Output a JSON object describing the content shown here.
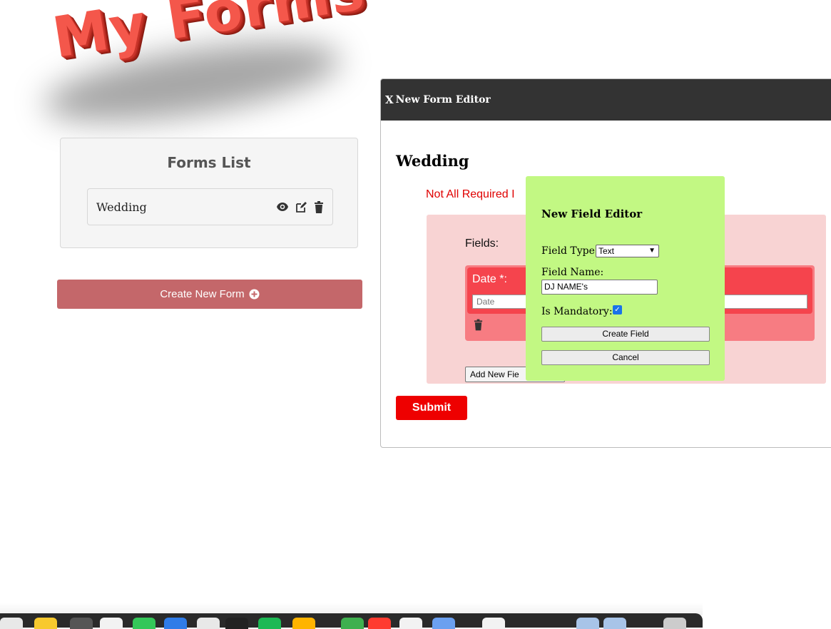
{
  "logo": {
    "text": "My Forms"
  },
  "forms_list": {
    "title": "Forms List",
    "items": [
      {
        "name": "Wedding"
      }
    ],
    "create_button_label": "Create New Form"
  },
  "editor": {
    "close_label": "X",
    "header_title": "New Form Editor",
    "form_title": "Wedding",
    "error_message": "Not All Required I",
    "fields_label": "Fields:",
    "field": {
      "label": "Date *:",
      "placeholder": "Date"
    },
    "add_field_label": "Add New Fie",
    "submit_label": "Submit"
  },
  "field_editor": {
    "title": "New Field Editor",
    "field_type_label": "Field Type:",
    "field_type_value": "Text",
    "field_name_label": "Field Name:",
    "field_name_value": "DJ NAME's",
    "mandatory_label": "Is Mandatory:",
    "mandatory_checked": true,
    "create_label": "Create Field",
    "cancel_label": "Cancel"
  },
  "dock": {
    "icons": [
      "finder-icon",
      "notes-icon",
      "launchpad-icon",
      "safari-icon",
      "messages-icon",
      "mail-icon",
      "chrome-icon",
      "github-icon",
      "spotify-icon",
      "app-icon",
      "app-icon",
      "app-icon",
      "app-icon",
      "app-icon",
      "doc-icon",
      "window-icon",
      "window-icon",
      "trash-icon"
    ],
    "colors": [
      "#e8e8e8",
      "#f8c92e",
      "#555555",
      "#f2f2f2",
      "#34c759",
      "#2f7ce8",
      "#e8e8e8",
      "#222222",
      "#1db954",
      "#ffb400",
      "#3fb04f",
      "#ff3b30",
      "#f2f2f2",
      "#6ba0f0",
      "#f2f2f2",
      "#a8c4e8",
      "#a8c4e8",
      "#cccccc"
    ]
  }
}
